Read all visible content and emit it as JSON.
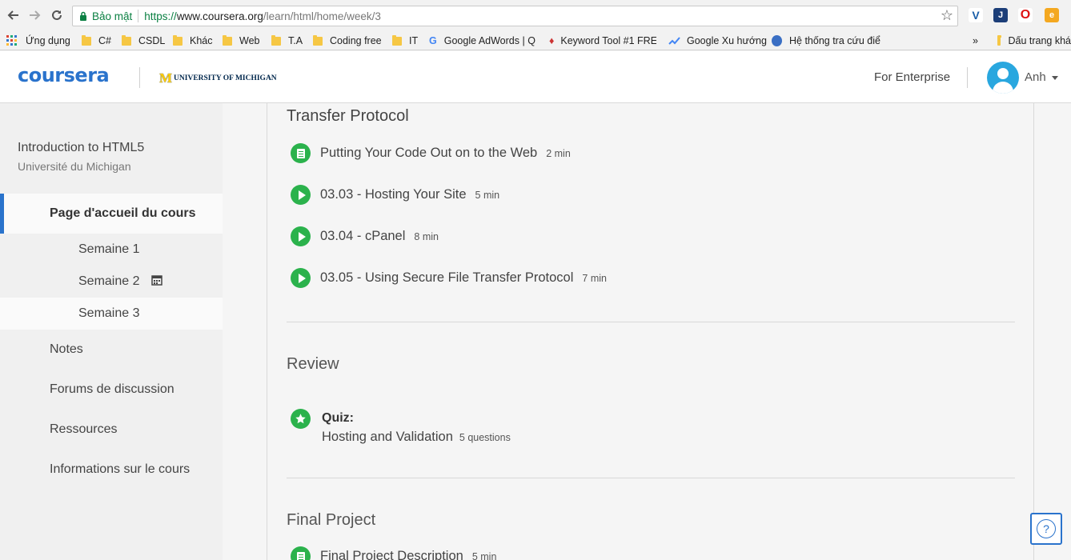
{
  "browser": {
    "secure_label": "Bảo mật",
    "url_scheme": "https://",
    "url_host": "www.coursera.org",
    "url_path": "/learn/html/home/week/3",
    "bookmarks": [
      "Ứng dụng",
      "C#",
      "CSDL",
      "Khác",
      "Web",
      "T.A",
      "Coding free",
      "IT",
      "Google AdWords | Q",
      "Keyword Tool #1 FRE",
      "Google Xu hướng",
      "Hệ thống tra cứu điể"
    ],
    "more_label": "»",
    "other_bookmarks": "Dấu trang khá"
  },
  "header": {
    "logo": "coursera",
    "partner_m": "M",
    "partner": "UNIVERSITY OF MICHIGAN",
    "enterprise": "For Enterprise",
    "user": "Anh"
  },
  "sidebar": {
    "course_title": "Introduction to HTML5",
    "course_sub": "Université du Michigan",
    "home": "Page d'accueil du cours",
    "weeks": [
      "Semaine 1",
      "Semaine 2",
      "Semaine 3"
    ],
    "items": [
      "Notes",
      "Forums de discussion",
      "Ressources",
      "Informations sur le cours"
    ]
  },
  "main": {
    "lesson_title": "Transfer Protocol",
    "items": [
      {
        "name": "Putting Your Code Out on to the Web",
        "duration": "2 min",
        "type": "reading"
      },
      {
        "name": "03.03 - Hosting Your Site",
        "duration": "5 min",
        "type": "video"
      },
      {
        "name": "03.04 - cPanel",
        "duration": "8 min",
        "type": "video"
      },
      {
        "name": "03.05 - Using Secure File Transfer Protocol",
        "duration": "7 min",
        "type": "video"
      }
    ],
    "review_title": "Review",
    "quiz": {
      "label": "Quiz:",
      "name": "Hosting and Validation",
      "questions": "5 questions"
    },
    "final_title": "Final Project",
    "final_item": {
      "name": "Final Project Description",
      "duration": "5 min"
    }
  },
  "help_label": "?"
}
